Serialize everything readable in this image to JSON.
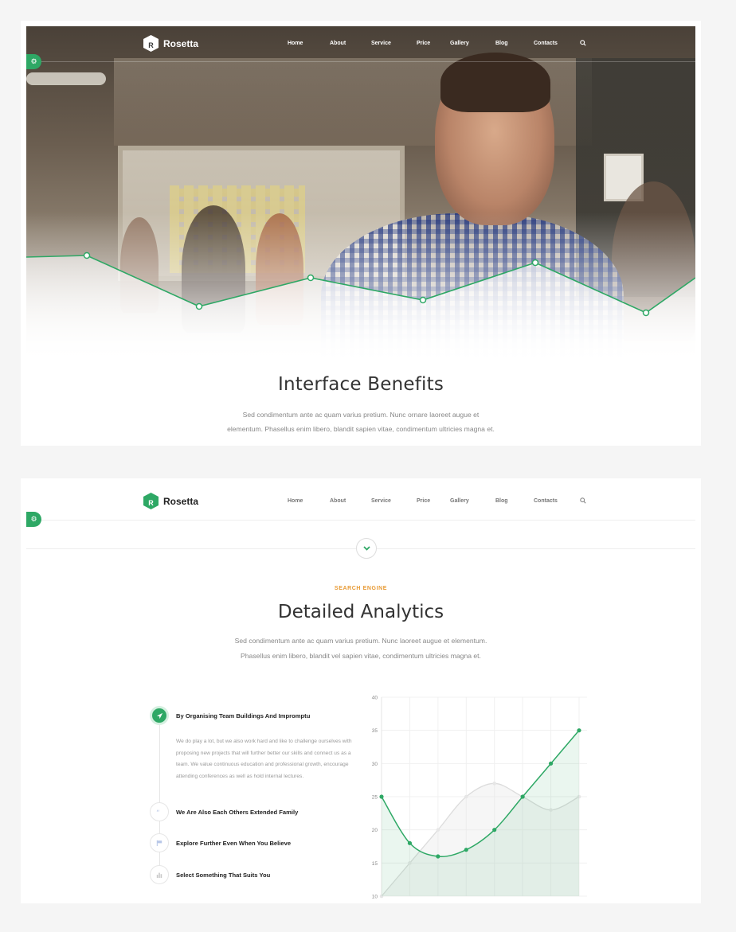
{
  "brand": {
    "name": "Rosetta",
    "accent": "#2ea865",
    "kicker_color": "#e89b36"
  },
  "nav": {
    "items": [
      "Home",
      "About",
      "Service",
      "Price",
      "Gallery",
      "Blog",
      "Contacts"
    ],
    "search_icon": "search-icon"
  },
  "settings_icon": "gear-icon",
  "panel1": {
    "title": "Interface Benefits",
    "desc_line1": "Sed condimentum ante ac quam varius pretium. Nunc ornare laoreet augue et",
    "desc_line2": "elementum. Phasellus enim libero, blandit sapien vitae, condimentum ultricies magna et."
  },
  "panel2": {
    "kicker": "SEARCH ENGINE",
    "title": "Detailed Analytics",
    "desc_line1": "Sed condimentum ante ac quam varius pretium. Nunc laoreet augue et elementum.",
    "desc_line2": "Phasellus enim libero, blandit vel sapien vitae, condimentum ultricies magna et.",
    "steps": [
      {
        "title": "By Organising Team Buildings And Impromptu",
        "icon": "rocket-icon",
        "text": "We do play a lot, but we also work hard and like to challenge ourselves with proposing new projects that will further better our skills and connect us as a team. We value continuous education and professional growth, encourage attending conferences as well as hold internal lectures."
      },
      {
        "title": "We Are Also Each Others Extended Family",
        "icon": "quote-icon"
      },
      {
        "title": "Explore Further Even When You Believe",
        "icon": "flag-icon"
      },
      {
        "title": "Select Something That Suits You",
        "icon": "bar-chart-icon"
      }
    ]
  },
  "chart_data": {
    "type": "line",
    "y_ticks": [
      "40",
      "35",
      "30",
      "25",
      "20",
      "15",
      "10"
    ],
    "ylim": [
      10,
      40
    ],
    "x": [
      0,
      1,
      2,
      3,
      4,
      5,
      6,
      7
    ],
    "grid": true,
    "series": [
      {
        "color": "#2ea865",
        "values": [
          25,
          18,
          16,
          17,
          20,
          25,
          30,
          35
        ]
      },
      {
        "color": "#dcdcdc",
        "values": [
          10,
          15,
          20,
          25,
          27,
          25,
          23,
          25
        ]
      }
    ]
  }
}
